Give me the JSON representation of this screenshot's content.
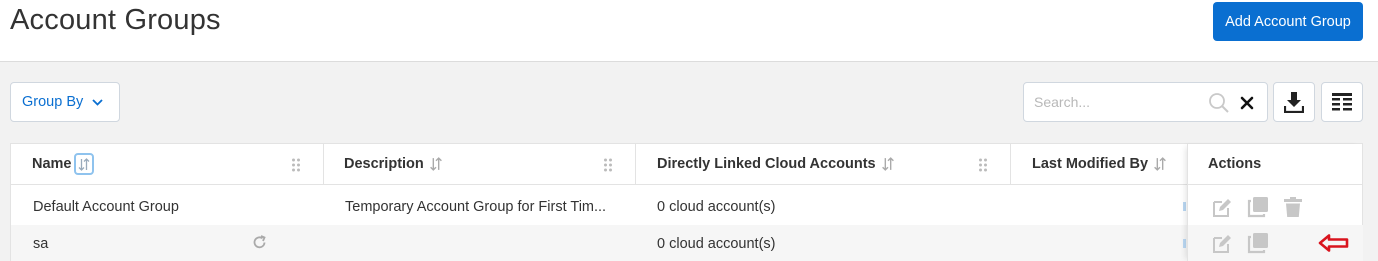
{
  "header": {
    "title": "Account Groups",
    "add_button": "Add Account Group"
  },
  "toolbar": {
    "group_by_label": "Group By",
    "search_placeholder": "Search...",
    "search_value": ""
  },
  "table": {
    "columns": [
      {
        "label": "Name",
        "sort": "active"
      },
      {
        "label": "Description",
        "sort": "none"
      },
      {
        "label": "Directly Linked Cloud Accounts",
        "sort": "none"
      },
      {
        "label": "Last Modified By",
        "sort": "none"
      },
      {
        "label": "Actions"
      }
    ],
    "rows": [
      {
        "name": "Default Account Group",
        "description": "Temporary Account Group for First Tim...",
        "linked": "0 cloud account(s)",
        "modified_by": ""
      },
      {
        "name": "sa",
        "description": "",
        "linked": "0 cloud account(s)",
        "modified_by": ""
      }
    ]
  },
  "icons": {
    "chevron": "chevron-down-icon",
    "search": "search-icon",
    "clear": "close-icon",
    "download": "download-icon",
    "columns": "columns-icon",
    "sort": "sort-icon",
    "drag": "drag-handle-icon",
    "edit": "edit-icon",
    "copy": "copy-icon",
    "delete": "trash-icon",
    "refresh": "refresh-icon",
    "pointer": "red-arrow-icon"
  },
  "colors": {
    "accent": "#0a6fd1",
    "icon_muted": "#c7c7c7",
    "arrow": "#d9141e"
  }
}
